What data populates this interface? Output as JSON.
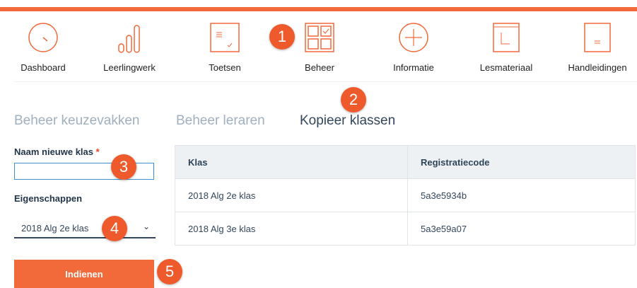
{
  "nav": [
    {
      "label": "Dashboard",
      "icon": "dashboard-gauge-icon"
    },
    {
      "label": "Leerlingwerk",
      "icon": "bar-chart-icon"
    },
    {
      "label": "Toetsen",
      "icon": "test-document-icon"
    },
    {
      "label": "Beheer",
      "icon": "grid-manage-icon"
    },
    {
      "label": "Informatie",
      "icon": "plus-circle-icon"
    },
    {
      "label": "Lesmateriaal",
      "icon": "book-icon"
    },
    {
      "label": "Handleidingen",
      "icon": "manual-icon"
    }
  ],
  "tabs": [
    {
      "label": "Beheer keuzevakken",
      "active": false
    },
    {
      "label": "Beheer leraren",
      "active": false
    },
    {
      "label": "Kopieer klassen",
      "active": true
    }
  ],
  "form": {
    "name_label": "Naam nieuwe klas",
    "required_marker": "*",
    "name_value": "",
    "properties_label": "Eigenschappen",
    "properties_selected": "2018 Alg 2e klas",
    "submit_label": "Indienen"
  },
  "table": {
    "headers": [
      "Klas",
      "Registratiecode"
    ],
    "rows": [
      [
        "2018 Alg 2e klas",
        "5a3e5934b"
      ],
      [
        "2018 Alg 3e klas",
        "5a3e59a07"
      ]
    ]
  },
  "badges": [
    "1",
    "2",
    "3",
    "4",
    "5"
  ],
  "colors": {
    "accent": "#f2693a",
    "badge": "#ee5a2c",
    "text": "#33475b",
    "muted": "#9fb0be"
  }
}
